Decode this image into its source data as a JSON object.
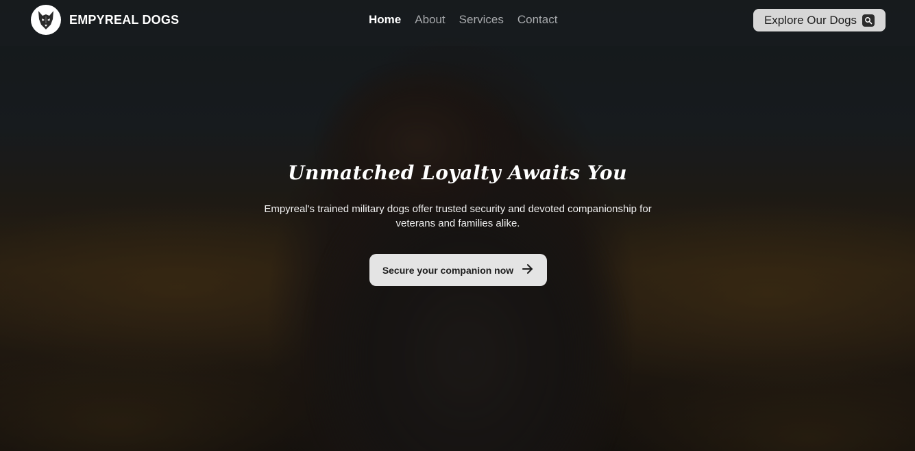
{
  "brand": {
    "name": "EMPYREAL DOGS",
    "logo_icon": "wolf-head-logo"
  },
  "nav": {
    "items": [
      {
        "label": "Home",
        "active": true
      },
      {
        "label": "About",
        "active": false
      },
      {
        "label": "Services",
        "active": false
      },
      {
        "label": "Contact",
        "active": false
      }
    ]
  },
  "header_cta": {
    "label": "Explore Our Dogs",
    "icon": "search-icon"
  },
  "hero": {
    "title": "Unmatched Loyalty Awaits You",
    "subtitle": "Empyreal's trained military dogs offer trusted security and devoted companionship for veterans and families alike.",
    "cta_label": "Secure your companion now",
    "cta_icon": "arrow-right-icon"
  },
  "colors": {
    "nav_bg": "#181c1f",
    "button_bg": "#d7d7d7",
    "active_link": "#ffffff",
    "inactive_link": "#a7a9ac"
  }
}
